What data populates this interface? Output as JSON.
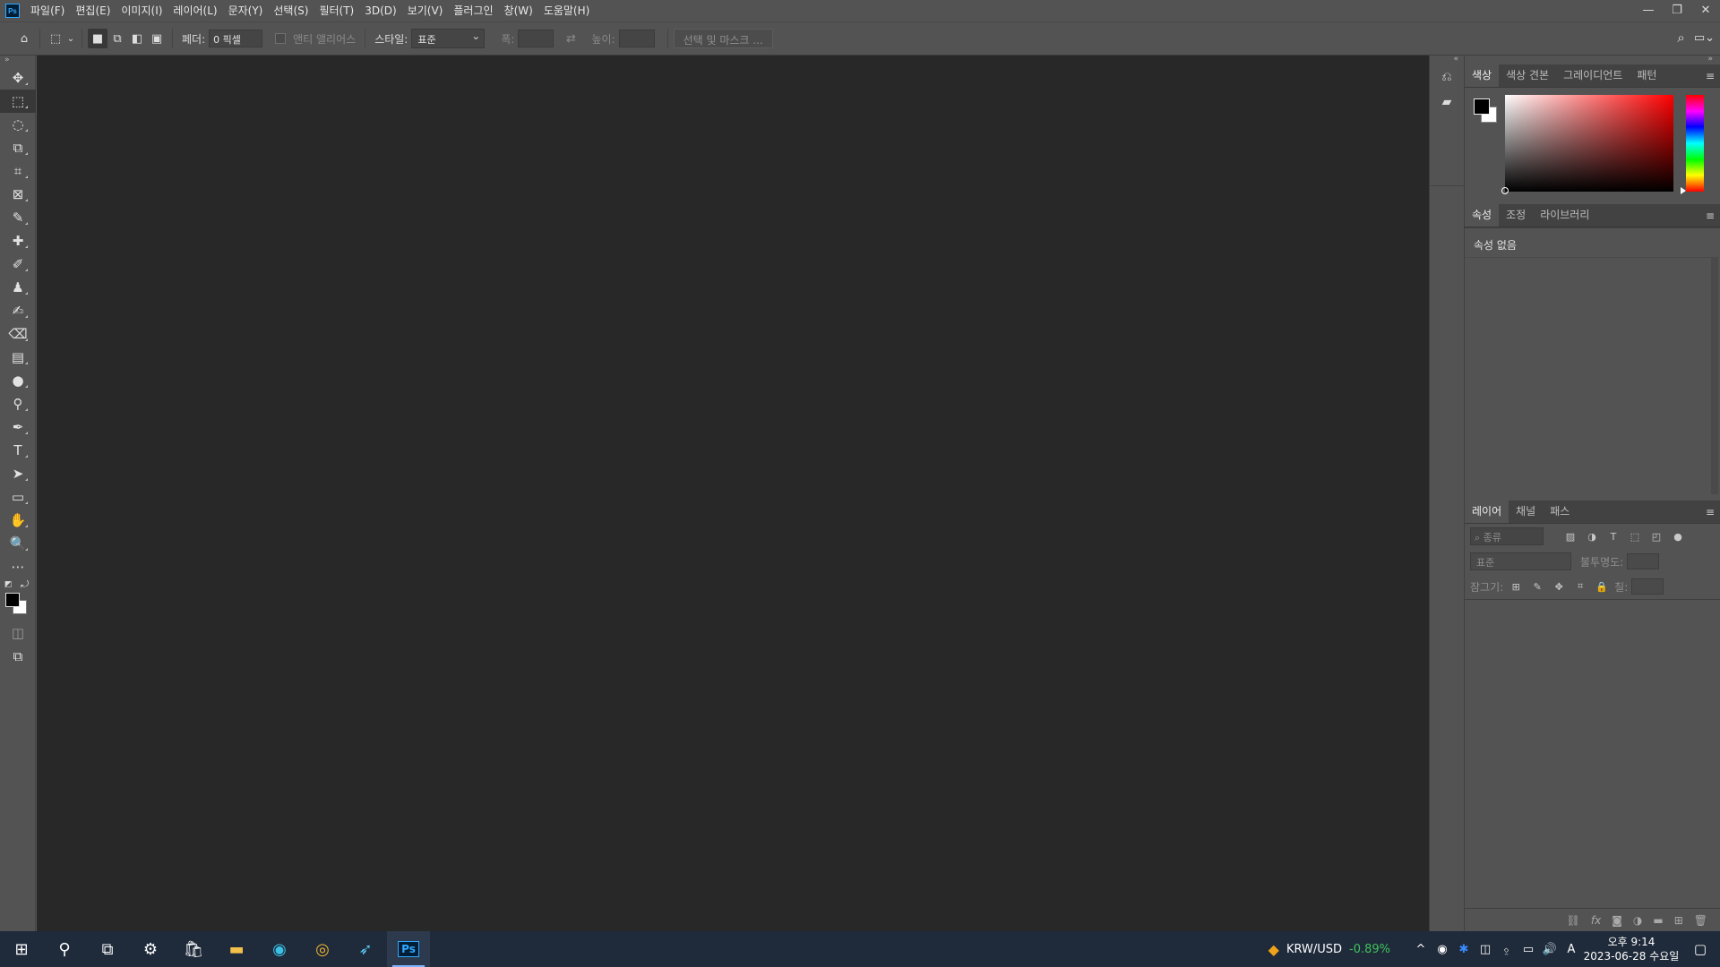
{
  "menubar": {
    "app_logo": "Ps",
    "items": [
      {
        "label": "파일(F)"
      },
      {
        "label": "편집(E)"
      },
      {
        "label": "이미지(I)"
      },
      {
        "label": "레이어(L)"
      },
      {
        "label": "문자(Y)"
      },
      {
        "label": "선택(S)"
      },
      {
        "label": "필터(T)"
      },
      {
        "label": "3D(D)"
      },
      {
        "label": "보기(V)"
      },
      {
        "label": "플러그인"
      },
      {
        "label": "창(W)"
      },
      {
        "label": "도움말(H)"
      }
    ],
    "window_controls": {
      "minimize": "—",
      "restore": "❐",
      "close": "✕"
    }
  },
  "options": {
    "home_icon": "home-icon",
    "feather_label": "페더:",
    "feather_value": "0 픽셀",
    "antialias_label": "앤티 앨리어스",
    "style_label": "스타일:",
    "style_value": "표준",
    "width_label": "폭:",
    "height_label": "높이:",
    "select_mask_label": "선택 및 마스크 ..."
  },
  "tools": [
    {
      "name": "move-tool-icon",
      "glyph": "✥"
    },
    {
      "name": "marquee-tool-icon",
      "glyph": "⬚"
    },
    {
      "name": "lasso-tool-icon",
      "glyph": "◌"
    },
    {
      "name": "object-select-tool-icon",
      "glyph": "⧉"
    },
    {
      "name": "crop-tool-icon",
      "glyph": "⌗"
    },
    {
      "name": "frame-tool-icon",
      "glyph": "⊠"
    },
    {
      "name": "eyedropper-tool-icon",
      "glyph": "✎"
    },
    {
      "name": "healing-brush-tool-icon",
      "glyph": "✚"
    },
    {
      "name": "brush-tool-icon",
      "glyph": "✐"
    },
    {
      "name": "stamp-tool-icon",
      "glyph": "♟"
    },
    {
      "name": "history-brush-tool-icon",
      "glyph": "✍"
    },
    {
      "name": "eraser-tool-icon",
      "glyph": "⌫"
    },
    {
      "name": "gradient-tool-icon",
      "glyph": "▤"
    },
    {
      "name": "blur-tool-icon",
      "glyph": "●"
    },
    {
      "name": "dodge-tool-icon",
      "glyph": "⚲"
    },
    {
      "name": "pen-tool-icon",
      "glyph": "✒"
    },
    {
      "name": "type-tool-icon",
      "glyph": "T"
    },
    {
      "name": "path-select-tool-icon",
      "glyph": "➤"
    },
    {
      "name": "rectangle-tool-icon",
      "glyph": "▭"
    },
    {
      "name": "hand-tool-icon",
      "glyph": "✋"
    },
    {
      "name": "zoom-tool-icon",
      "glyph": "🔍"
    },
    {
      "name": "more-tools-icon",
      "glyph": "⋯"
    }
  ],
  "color_panel": {
    "tabs": [
      {
        "label": "색상"
      },
      {
        "label": "색상 견본"
      },
      {
        "label": "그레이디언트"
      },
      {
        "label": "패턴"
      }
    ],
    "foreground": "#000000",
    "background": "#ffffff"
  },
  "properties_panel": {
    "tabs": [
      {
        "label": "속성"
      },
      {
        "label": "조정"
      },
      {
        "label": "라이브러리"
      }
    ],
    "empty_text": "속성 없음"
  },
  "layers_panel": {
    "tabs": [
      {
        "label": "레이어"
      },
      {
        "label": "채널"
      },
      {
        "label": "패스"
      }
    ],
    "filter_placeholder": "종류",
    "blend_mode": "표준",
    "opacity_label": "불투명도:",
    "lock_label": "잠그기:",
    "fill_label": "칠:"
  },
  "taskbar": {
    "ticker_symbol": "KRW/USD",
    "ticker_change": "-0.89%",
    "clock_time": "오후 9:14",
    "clock_date": "2023-06-28 수요일",
    "ime_label": "A",
    "ps_label": "Ps"
  },
  "colors": {
    "accent": "#31a8ff",
    "ticker_positive": "#3fc35b",
    "canvas_bg": "#282828",
    "ui_bg": "#535353"
  }
}
